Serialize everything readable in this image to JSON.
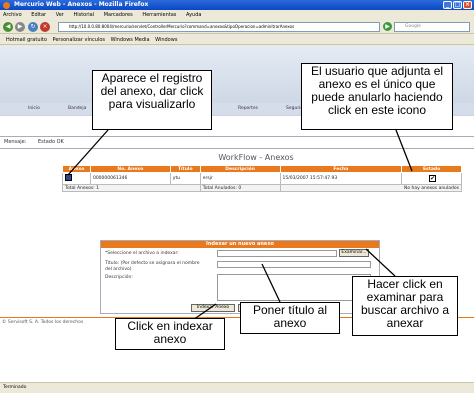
{
  "window": {
    "title": "Mercurio Web - Anexos - Mozilla Firefox",
    "minimize": "_",
    "maximize": "□",
    "close": "×"
  },
  "menu": [
    "Archivo",
    "Editar",
    "Ver",
    "Historial",
    "Marcadores",
    "Herramientas",
    "Ayuda"
  ],
  "nav": {
    "url": "http://10.0.0.80:8004/mercurio/servlet/ControllerMercurio?command=anexos&tipoOperacion=adminitrarAnexos",
    "search_placeholder": "Google"
  },
  "bookmarks": [
    "Hotmail gratuito",
    "Personalizar vínculos",
    "Windows Media",
    "Windows"
  ],
  "app_menu": [
    "Inicio",
    "Bandeja",
    "Reportes",
    "Seguridad",
    "A"
  ],
  "message": {
    "label": "Mensaje:",
    "value": "Estado OK"
  },
  "workflow_title": "WorkFlow - Anexos",
  "table": {
    "headers": [
      "Anexo",
      "No. Anexo",
      "Título",
      "Descripción",
      "Fecha",
      "Estado"
    ],
    "row": {
      "number": "000000061346",
      "title": "ytu",
      "description": "ersjr",
      "date": "15/03/2007 15:57:47.93",
      "check": "✔"
    },
    "total_anexos": "Total Anexos: 1",
    "total_anulados": "Total Anulados: 0",
    "no_anulados": "No hay anexos anulados"
  },
  "form": {
    "header": "Indexar un nuevo anexo",
    "select_label": "*Seleccione el archivo a indexar:",
    "browse_button": "Examinar...",
    "title_label_1": "Título: (Por defecto se asignara el nombre",
    "title_label_2": "del archivo)",
    "description_label": "Descripción:",
    "index_button": "Indexar Anexo",
    "back_button": "Volver a la Bandeja"
  },
  "copyright": "© Servisoft S. A. Todos los derechos",
  "status": "Terminado",
  "callouts": {
    "registro": "Aparece el registro del anexo, dar click para visualizarlo",
    "usuario": "El usuario que adjunta el anexo es el único que puede anularlo haciendo click en este icono",
    "examinar": "Hacer click en examinar para buscar archivo a anexar",
    "titulo": "Poner título al anexo",
    "indexar": "Click en indexar anexo"
  }
}
